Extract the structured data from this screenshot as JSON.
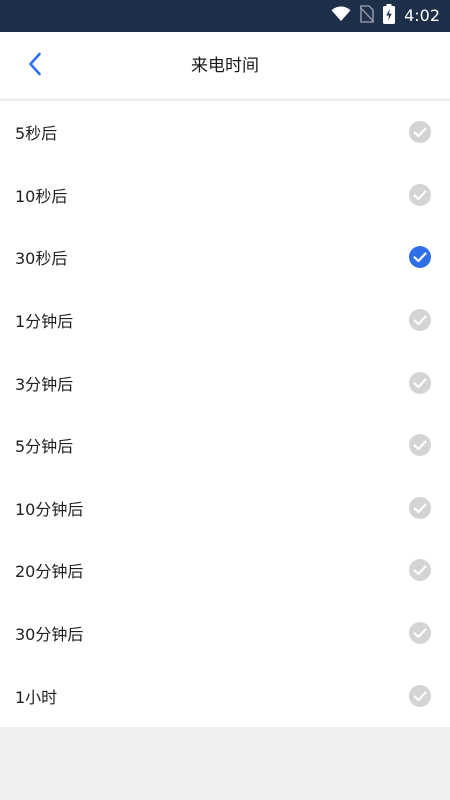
{
  "status_bar": {
    "time": "4:02",
    "icons": [
      "wifi-icon",
      "no-sim-icon",
      "battery-charging-icon"
    ]
  },
  "header": {
    "title": "来电时间",
    "back_icon": "chevron-left-icon"
  },
  "options": [
    {
      "label": "5秒后",
      "selected": false
    },
    {
      "label": "10秒后",
      "selected": false
    },
    {
      "label": "30秒后",
      "selected": true
    },
    {
      "label": "1分钟后",
      "selected": false
    },
    {
      "label": "3分钟后",
      "selected": false
    },
    {
      "label": "5分钟后",
      "selected": false
    },
    {
      "label": "10分钟后",
      "selected": false
    },
    {
      "label": "20分钟后",
      "selected": false
    },
    {
      "label": "30分钟后",
      "selected": false
    },
    {
      "label": "1小时",
      "selected": false
    }
  ],
  "colors": {
    "status_bar_bg": "#1e2f49",
    "accent": "#2f6fe8",
    "unselected_check": "#d4d4d4",
    "page_bg": "#efefef"
  }
}
